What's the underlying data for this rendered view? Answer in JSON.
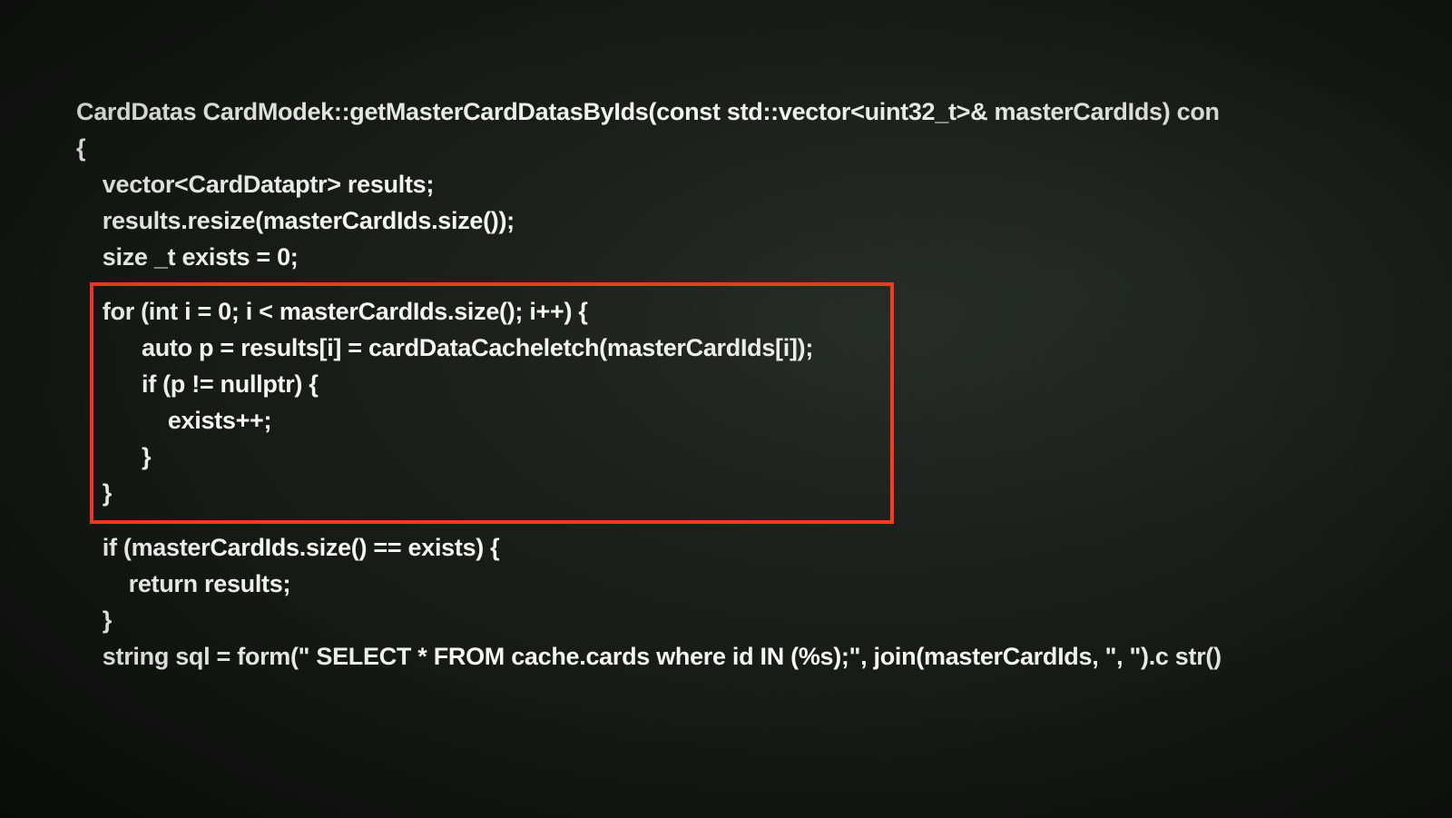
{
  "code": {
    "lines": [
      "CardDatas CardModek::getMasterCardDatasByIds(const std::vector<uint32_t>& masterCardIds) con",
      "{",
      "    vector<CardDataptr> results;",
      "    results.resize(masterCardIds.size());",
      "    size _t exists = 0;",
      "",
      "    for (int i = 0; i < masterCardIds.size(); i++) {",
      "          auto p = results[i] = cardDataCacheletch(masterCardIds[i]);",
      "          if (p != nullptr) {",
      "              exists++;",
      "          }",
      "    }",
      "",
      "    if (masterCardIds.size() == exists) {",
      "        return results;",
      "    }",
      "    string sql = form(\" SELECT * FROM cache.cards where id IN (%s);\", join(masterCardIds, \", \").c str()"
    ]
  },
  "highlight": {
    "start_line_index": 6,
    "end_line_index": 11
  }
}
